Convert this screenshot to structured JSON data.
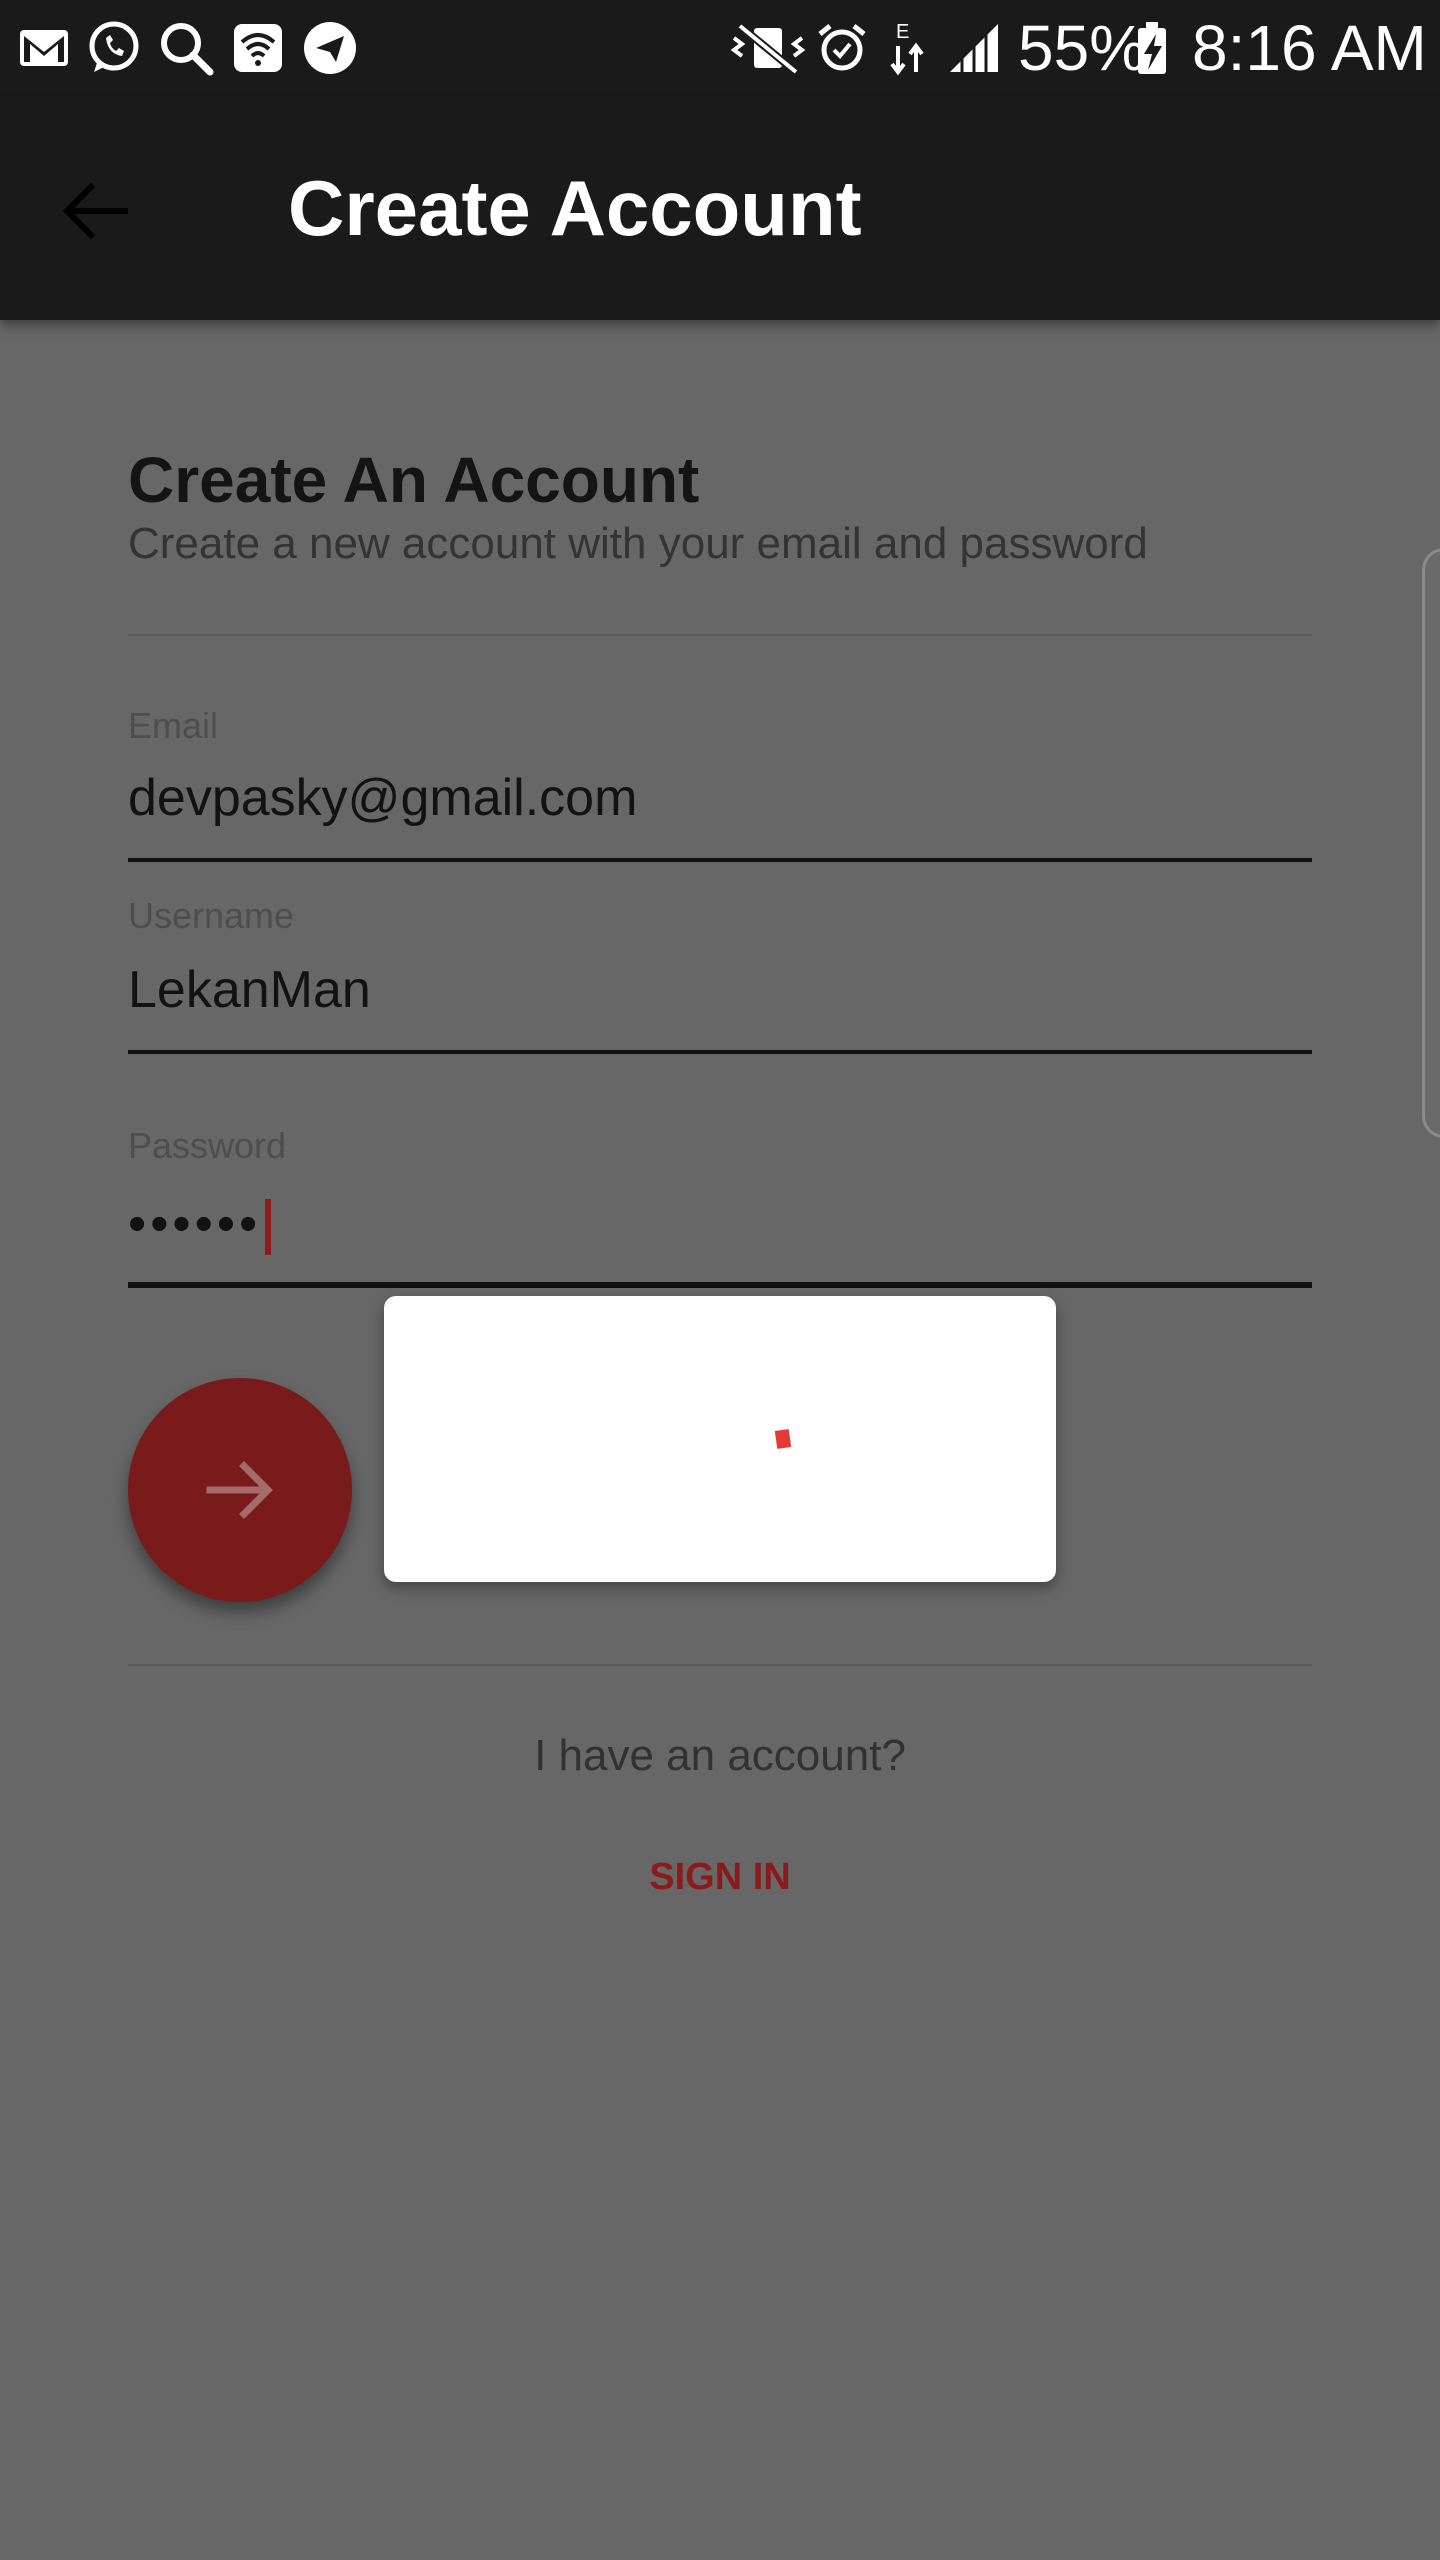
{
  "status_bar": {
    "battery": "55%",
    "time": "8:16 AM"
  },
  "app_bar": {
    "title": "Create Account"
  },
  "form": {
    "title": "Create An Account",
    "subtitle": "Create a new account with your email and password",
    "email": {
      "label": "Email",
      "value": "devpasky@gmail.com"
    },
    "username": {
      "label": "Username",
      "value": "LekanMan"
    },
    "password": {
      "label": "Password",
      "value": "••••••"
    }
  },
  "footer": {
    "question": "I have an account?",
    "sign_in_label": "SIGN IN"
  },
  "colors": {
    "accent": "#8b1a1a",
    "fab": "#7a1b1b",
    "spinner": "#e53935",
    "toolbar": "#1a1a1a",
    "scrim": "#676767"
  }
}
